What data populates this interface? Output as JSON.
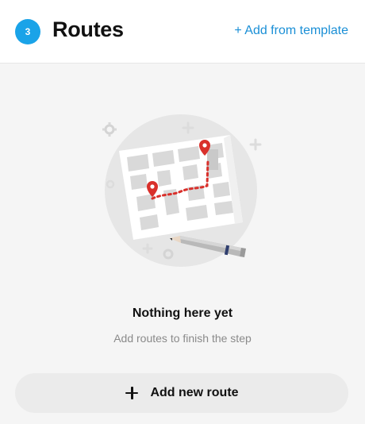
{
  "header": {
    "step_number": "3",
    "title": "Routes",
    "template_link": "+ Add from template"
  },
  "empty_state": {
    "illustration_icon": "route-map-illustration",
    "title": "Nothing here yet",
    "subtitle": "Add routes to finish the step"
  },
  "actions": {
    "add_route_label": "Add new route",
    "add_route_icon": "plus-icon"
  },
  "colors": {
    "accent": "#1aa3e8",
    "link": "#1a8fd6",
    "pin": "#d9302b",
    "background": "#f5f5f5",
    "button": "#ebebeb"
  }
}
